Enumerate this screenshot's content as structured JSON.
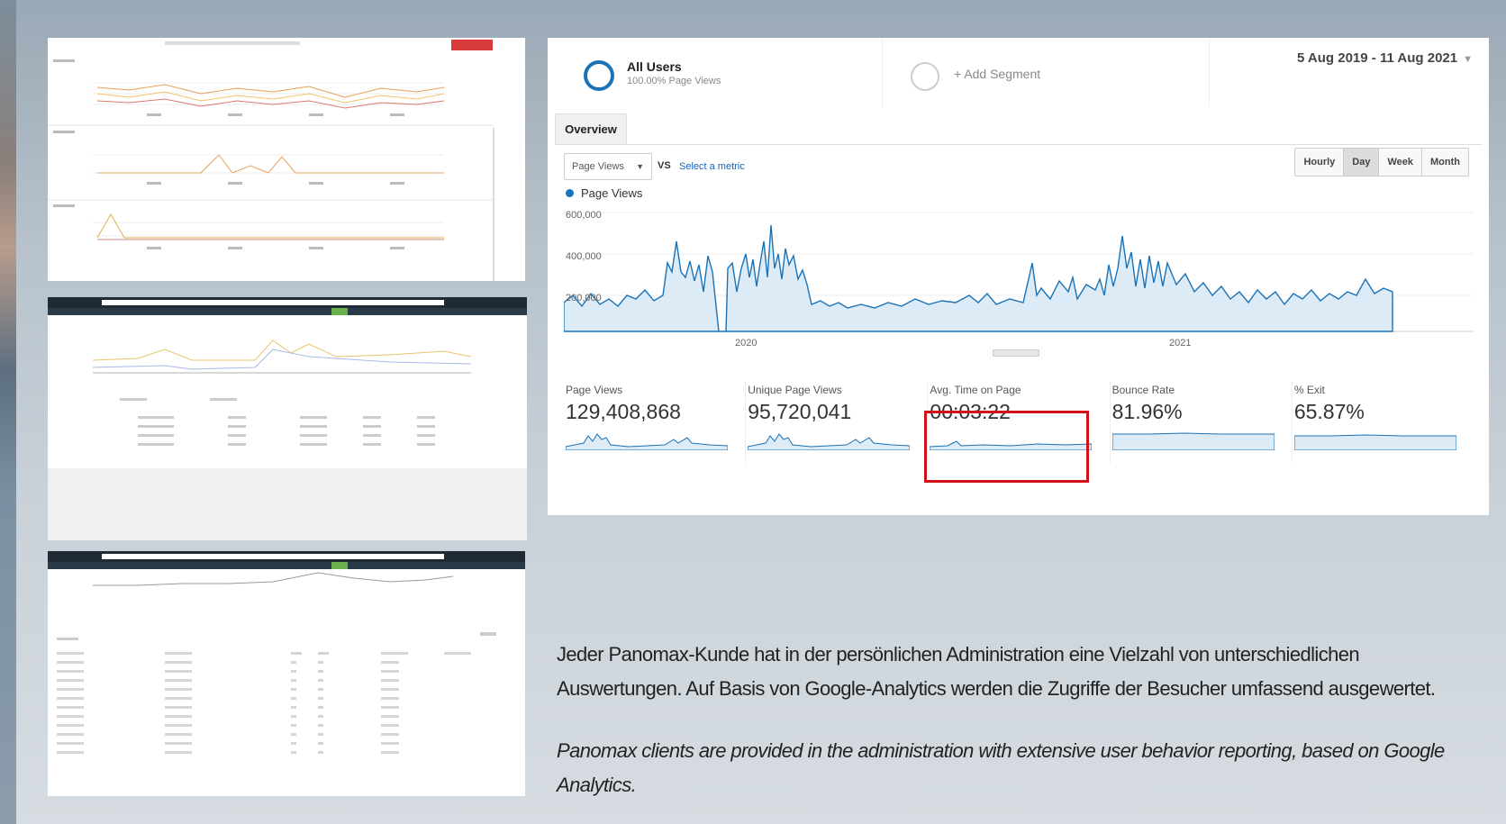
{
  "segments": {
    "all_users_title": "All Users",
    "all_users_sub": "100.00% Page Views",
    "add_segment": "+ Add Segment"
  },
  "date_range": "5 Aug 2019 - 11 Aug 2021",
  "tabs": {
    "overview": "Overview"
  },
  "controls": {
    "metric": "Page Views",
    "vs": "VS",
    "select_metric": "Select a metric",
    "granularity": [
      "Hourly",
      "Day",
      "Week",
      "Month"
    ],
    "active_granularity": "Day"
  },
  "chart_data": {
    "type": "area",
    "series": [
      {
        "name": "Page Views"
      }
    ],
    "y_ticks": [
      "600,000",
      "400,000",
      "200,000"
    ],
    "x_ticks": [
      "2020",
      "2021"
    ],
    "ylim": [
      0,
      600000
    ],
    "color": "#1a73b8"
  },
  "kpis": [
    {
      "label": "Page Views",
      "value": "129,408,868"
    },
    {
      "label": "Unique Page Views",
      "value": "95,720,041"
    },
    {
      "label": "Avg. Time on Page",
      "value": "00:03:22"
    },
    {
      "label": "Bounce Rate",
      "value": "81.96%"
    },
    {
      "label": "% Exit",
      "value": "65.87%"
    }
  ],
  "highlight_color": "#d0111b",
  "text": {
    "german": "Jeder Panomax-Kunde hat in der persönlichen Administration eine Vielzahl von unterschiedlichen Auswertungen. Auf Basis von Google-Analytics werden die Zugriffe der Besucher umfassend ausgewertet.",
    "english": "Panomax clients are provided in the administration with extensive user behavior reporting, based on Google Analytics."
  }
}
